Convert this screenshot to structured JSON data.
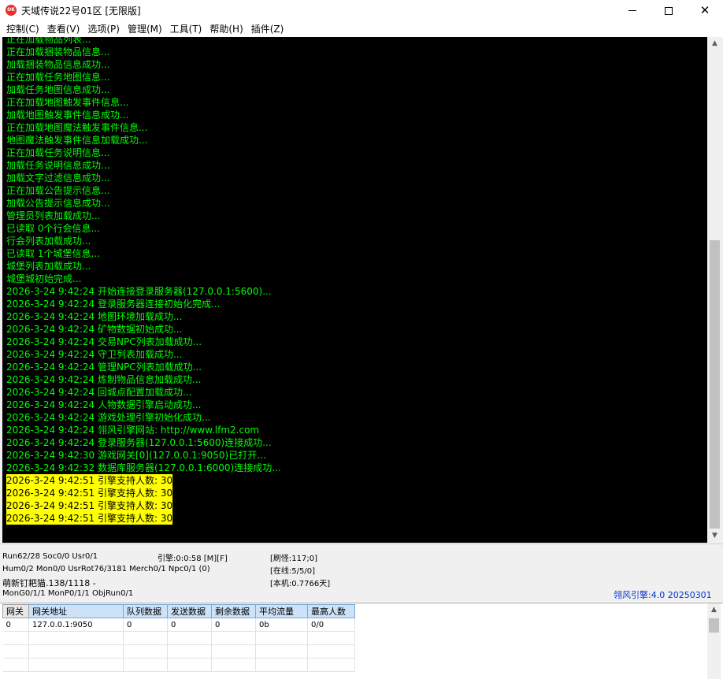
{
  "window": {
    "title": "天域传说22号01区 [无限版]",
    "icon_label": "OK"
  },
  "menu": [
    "控制(C)",
    "查看(V)",
    "选项(P)",
    "管理(M)",
    "工具(T)",
    "帮助(H)",
    "插件(Z)"
  ],
  "console": {
    "text_color": "#00ff00",
    "highlight_color": "#ffff00",
    "lines": [
      {
        "text": "正在加载物品列表...",
        "hl": false
      },
      {
        "text": "正在加载捆装物品信息...",
        "hl": false
      },
      {
        "text": "加载捆装物品信息成功...",
        "hl": false
      },
      {
        "text": "正在加载任务地图信息...",
        "hl": false
      },
      {
        "text": "加载任务地图信息成功...",
        "hl": false
      },
      {
        "text": "正在加载地图触发事件信息...",
        "hl": false
      },
      {
        "text": "加载地图触发事件信息成功...",
        "hl": false
      },
      {
        "text": "正在加载地图魔法触发事件信息...",
        "hl": false
      },
      {
        "text": "地图魔法触发事件信息加载成功...",
        "hl": false
      },
      {
        "text": "正在加载任务说明信息...",
        "hl": false
      },
      {
        "text": "加载任务说明信息成功...",
        "hl": false
      },
      {
        "text": "加载文字过滤信息成功...",
        "hl": false
      },
      {
        "text": "正在加载公告提示信息...",
        "hl": false
      },
      {
        "text": "加载公告提示信息成功...",
        "hl": false
      },
      {
        "text": "管理员列表加载成功...",
        "hl": false
      },
      {
        "text": "已读取 0个行会信息...",
        "hl": false
      },
      {
        "text": "行会列表加载成功...",
        "hl": false
      },
      {
        "text": "已读取 1个城堡信息...",
        "hl": false
      },
      {
        "text": "城堡列表加载成功...",
        "hl": false
      },
      {
        "text": "城堡城初始完成...",
        "hl": false
      },
      {
        "text": "2026-3-24 9:42:24 开始连接登录服务器(127.0.0.1:5600)...",
        "hl": false
      },
      {
        "text": "2026-3-24 9:42:24 登录服务器连接初始化完成...",
        "hl": false
      },
      {
        "text": "2026-3-24 9:42:24 地图环境加载成功...",
        "hl": false
      },
      {
        "text": "2026-3-24 9:42:24 矿物数据初始成功...",
        "hl": false
      },
      {
        "text": "2026-3-24 9:42:24 交易NPC列表加载成功...",
        "hl": false
      },
      {
        "text": "2026-3-24 9:42:24 守卫列表加载成功...",
        "hl": false
      },
      {
        "text": "2026-3-24 9:42:24 管理NPC列表加载成功...",
        "hl": false
      },
      {
        "text": "2026-3-24 9:42:24 炼制物品信息加载成功...",
        "hl": false
      },
      {
        "text": "2026-3-24 9:42:24 回城点配置加载成功...",
        "hl": false
      },
      {
        "text": "2026-3-24 9:42:24 人物数据引擎启动成功...",
        "hl": false
      },
      {
        "text": "2026-3-24 9:42:24 游戏处理引擎初始化成功...",
        "hl": false
      },
      {
        "text": "2026-3-24 9:42:24 翎风引擎网站: http://www.lfm2.com",
        "hl": false
      },
      {
        "text": "2026-3-24 9:42:24 登录服务器(127.0.0.1:5600)连接成功...",
        "hl": false
      },
      {
        "text": "2026-3-24 9:42:30 游戏网关[0](127.0.0.1:9050)已打开...",
        "hl": false
      },
      {
        "text": "2026-3-24 9:42:32 数据库服务器(127.0.0.1:6000)连接成功...",
        "hl": false
      },
      {
        "text": "2026-3-24 9:42:51 引擎支持人数: 30",
        "hl": true
      },
      {
        "text": "2026-3-24 9:42:51 引擎支持人数: 30",
        "hl": true
      },
      {
        "text": "2026-3-24 9:42:51 引擎支持人数: 30",
        "hl": true
      },
      {
        "text": "2026-3-24 9:42:51 引擎支持人数: 30",
        "hl": true
      }
    ]
  },
  "status": {
    "run": "Run62/28 Soc0/0 Usr0/1",
    "engine": "引擎:0:0:58 [M][F]",
    "refresh": "[刷怪:117;0]",
    "hum": "Hum0/2 Mon0/0 UsrRot76/3181 Merch0/1 Npc0/1 (0)",
    "online": "[在线:5/5/0]",
    "name_info": "萌新钉耙猫.138/1118 -",
    "local": "[本机:0.7766天]",
    "mon": "MonG0/1/1 MonP0/1/1 ObjRun0/1",
    "brand": "翎风引擎:4.0 20250301"
  },
  "gateway_table": {
    "headers": [
      "网关",
      "网关地址",
      "队列数据",
      "发送数据",
      "剩余数据",
      "平均流量",
      "最高人数"
    ],
    "rows": [
      [
        "0",
        "127.0.0.1:9050",
        "0",
        "0",
        "0",
        "0b",
        "0/0"
      ]
    ]
  }
}
